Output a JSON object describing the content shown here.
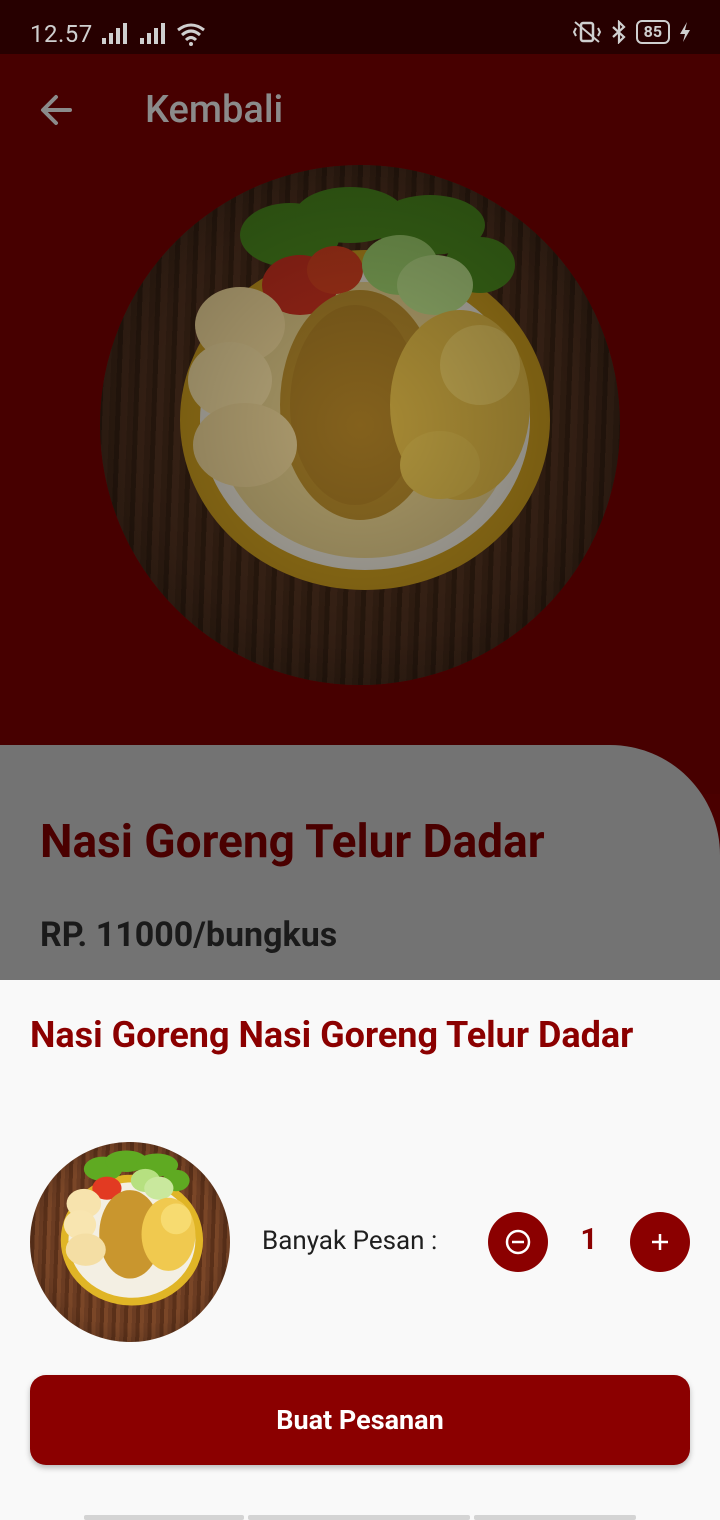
{
  "status_bar": {
    "time": "12.57",
    "battery": "85"
  },
  "header": {
    "back_label": "Kembali"
  },
  "product": {
    "name": "Nasi Goreng Telur Dadar",
    "price": "RP. 11000/bungkus"
  },
  "sheet": {
    "title": "Nasi Goreng Nasi Goreng Telur Dadar",
    "qty_label": "Banyak Pesan :",
    "qty_value": "1",
    "order_button": "Buat Pesanan"
  },
  "colors": {
    "accent": "#8b0000",
    "hero_bg": "#470000",
    "panel_bg": "#737373"
  }
}
